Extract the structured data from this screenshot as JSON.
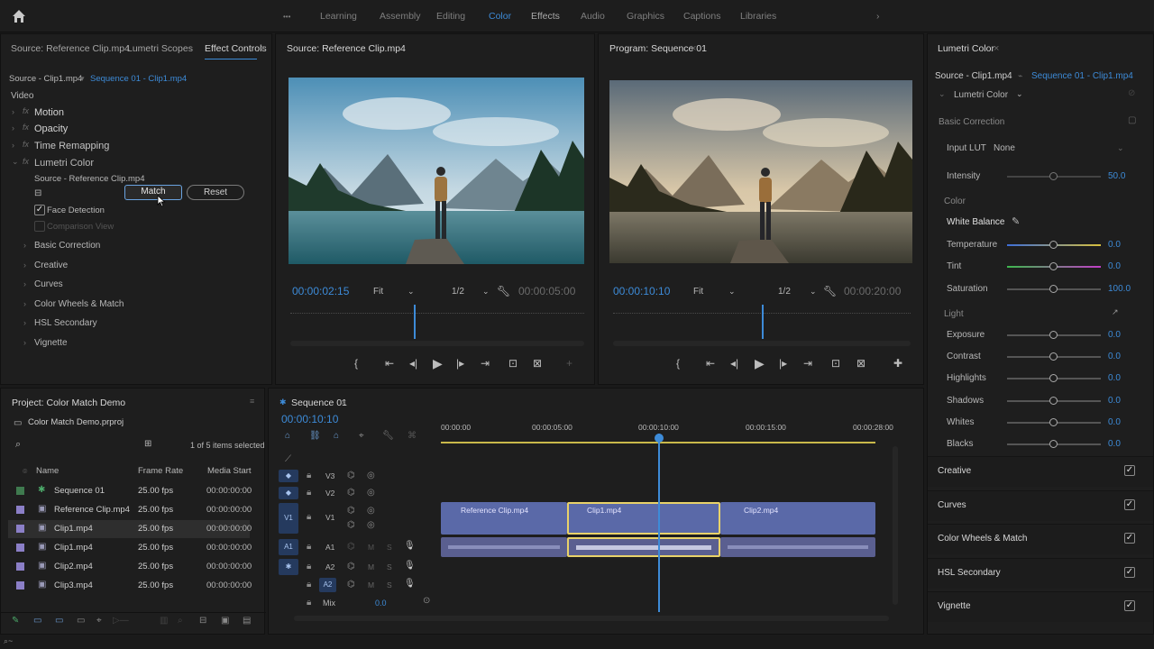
{
  "workspaces": [
    "Learning",
    "Assembly",
    "Editing",
    "Color",
    "Effects",
    "Audio",
    "Graphics",
    "Captions",
    "Libraries"
  ],
  "active_workspace": "Color",
  "effect_panel": {
    "tabs": [
      "Source: Reference Clip.mp4",
      "Lumetri Scopes",
      "Effect Controls"
    ],
    "source_label": "Source - Clip1.mp4",
    "sequence_label": "Sequence 01 - Clip1.mp4",
    "section": "Video",
    "effects": [
      "Motion",
      "Opacity",
      "Time Remapping",
      "Lumetri Color"
    ],
    "lumetri_source": "Source - Reference Clip.mp4",
    "match_label": "Match",
    "reset_label": "Reset",
    "face_detection": "Face Detection",
    "comparison_view": "Comparison View",
    "subsections": [
      "Basic Correction",
      "Creative",
      "Curves",
      "Color Wheels & Match",
      "HSL Secondary",
      "Vignette"
    ]
  },
  "source_monitor": {
    "title": "Source: Reference Clip.mp4",
    "timecode": "00:00:02:15",
    "fit": "Fit",
    "res": "1/2",
    "duration": "00:00:05:00",
    "playhead_fraction": 0.42
  },
  "program_monitor": {
    "title": "Program: Sequence 01",
    "timecode": "00:00:10:10",
    "fit": "Fit",
    "res": "1/2",
    "duration": "00:00:20:00",
    "playhead_fraction": 0.5
  },
  "project": {
    "title": "Project: Color Match Demo",
    "file": "Color Match Demo.prproj",
    "selection": "1 of 5 items selected",
    "columns": [
      "Name",
      "Frame Rate",
      "Media Start"
    ],
    "items": [
      {
        "name": "Sequence 01",
        "fps": "25.00 fps",
        "start": "00:00:00:00",
        "color": "#3f7a4f"
      },
      {
        "name": "Reference Clip.mp4",
        "fps": "25.00 fps",
        "start": "00:00:00:00",
        "color": "#8b7fc7"
      },
      {
        "name": "Clip1.mp4",
        "fps": "25.00 fps",
        "start": "00:00:00:00",
        "color": "#8b7fc7"
      },
      {
        "name": "Clip1.mp4",
        "fps": "25.00 fps",
        "start": "00:00:00:00",
        "color": "#8b7fc7"
      },
      {
        "name": "Clip2.mp4",
        "fps": "25.00 fps",
        "start": "00:00:00:00",
        "color": "#8b7fc7"
      },
      {
        "name": "Clip3.mp4",
        "fps": "25.00 fps",
        "start": "00:00:00:00",
        "color": "#8b7fc7"
      }
    ]
  },
  "timeline": {
    "title": "Sequence 01",
    "timecode": "00:00:10:10",
    "ruler": [
      "00:00:00",
      "00:00:05:00",
      "00:00:10:00",
      "00:00:15:00",
      "00:00:28:00"
    ],
    "tracks_video": [
      "V3",
      "V2",
      "V1"
    ],
    "tracks_audio": [
      "A1",
      "A2",
      "A2"
    ],
    "clips": [
      "Reference Clip.mp4",
      "Clip1.mp4",
      "Clip2.mp4"
    ],
    "mix_label": "Mix",
    "mix_value": "0.0"
  },
  "lumetri": {
    "title": "Lumetri Color",
    "source_label": "Source - Clip1.mp4",
    "sequence_label": "Sequence 01 - Clip1.mp4",
    "dropdown": "Lumetri Color",
    "basic_correction": "Basic Correction",
    "input_lut_label": "Input LUT",
    "input_lut_value": "None",
    "intensity_label": "Intensity",
    "intensity_value": "50.0",
    "color_section": "Color",
    "white_balance": "White Balance",
    "temperature_label": "Temperature",
    "temperature_value": "0.0",
    "tint_label": "Tint",
    "tint_value": "0.0",
    "saturation_label": "Saturation",
    "saturation_value": "100.0",
    "light_section": "Light",
    "light_sliders": [
      {
        "label": "Exposure",
        "value": "0.0"
      },
      {
        "label": "Contrast",
        "value": "0.0"
      },
      {
        "label": "Highlights",
        "value": "0.0"
      },
      {
        "label": "Shadows",
        "value": "0.0"
      },
      {
        "label": "Whites",
        "value": "0.0"
      },
      {
        "label": "Blacks",
        "value": "0.0"
      }
    ],
    "sections": [
      "Creative",
      "Curves",
      "Color Wheels & Match",
      "HSL Secondary",
      "Vignette"
    ]
  },
  "colors": {
    "accent": "#3d8bd8",
    "clip": "#5a69a8",
    "selected_clip": "#e8d26a"
  }
}
